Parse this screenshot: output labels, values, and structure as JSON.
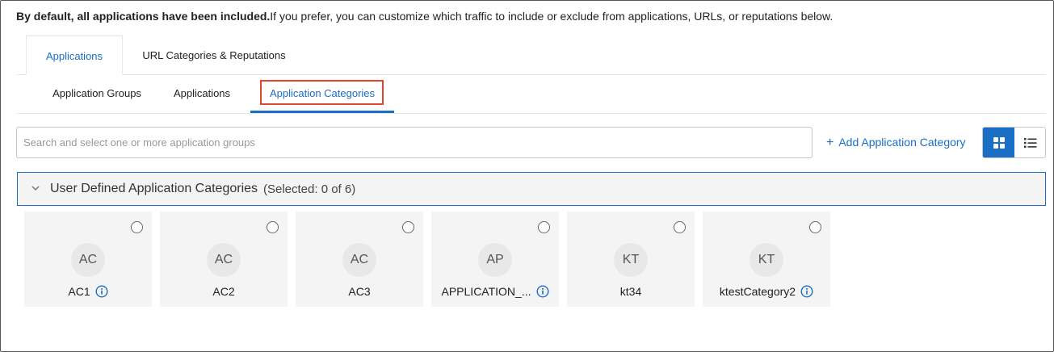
{
  "intro": {
    "bold": "By default, all applications have been included.",
    "rest": "If you prefer, you can customize which traffic to include or exclude from applications, URLs, or reputations below."
  },
  "top_tabs": [
    {
      "label": "Applications",
      "active": true
    },
    {
      "label": "URL Categories & Reputations",
      "active": false
    }
  ],
  "sub_tabs": [
    {
      "label": "Application Groups",
      "active": false
    },
    {
      "label": "Applications",
      "active": false
    },
    {
      "label": "Application Categories",
      "active": true
    }
  ],
  "search": {
    "placeholder": "Search and select one or more application groups",
    "value": ""
  },
  "add_button": {
    "label": "Add Application Category",
    "icon": "plus-icon"
  },
  "view_toggle": {
    "active": "grid",
    "options": [
      "grid-view-icon",
      "list-view-icon"
    ]
  },
  "section": {
    "title": "User Defined Application Categories",
    "count": "(Selected: 0 of 6)",
    "expanded": true
  },
  "cards": [
    {
      "initials": "AC",
      "name": "AC1",
      "info": true,
      "selected": false
    },
    {
      "initials": "AC",
      "name": "AC2",
      "info": false,
      "selected": false
    },
    {
      "initials": "AC",
      "name": "AC3",
      "info": false,
      "selected": false
    },
    {
      "initials": "AP",
      "name": "APPLICATION_...",
      "info": true,
      "selected": false
    },
    {
      "initials": "KT",
      "name": "kt34",
      "info": false,
      "selected": false
    },
    {
      "initials": "KT",
      "name": "ktestCategory2",
      "info": true,
      "selected": false
    }
  ],
  "colors": {
    "accent": "#1a6fc4",
    "highlight": "#e2452c",
    "card_bg": "#f4f4f4"
  }
}
